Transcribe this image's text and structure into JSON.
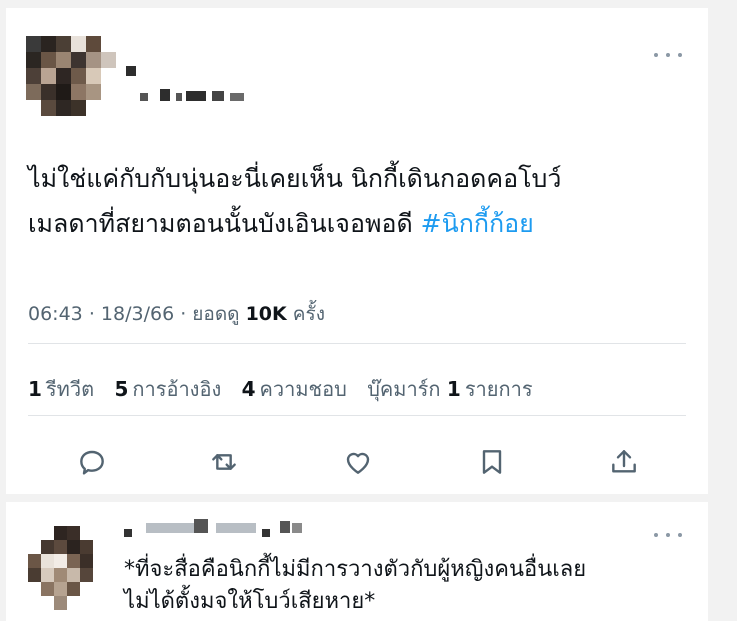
{
  "tweet": {
    "text_line1": "ไม่ใช่แค่กับกับนุ่นอะนี่เคยเห็น นิกกี้เดินกอดคอโบว์",
    "text_line2": "เมลดาที่สยามตอนนั้นบังเอินเจอพอดี ",
    "hashtag": "#นิกกี้ก้อย",
    "time": "06:43",
    "date": "18/3/66",
    "views_prefix": "ยอดดู",
    "views_count": "10K",
    "views_suffix": "ครั้ง"
  },
  "stats": {
    "retweets_count": "1",
    "retweets_label": "รีทวีต",
    "quotes_count": "5",
    "quotes_label": "การอ้างอิง",
    "likes_count": "4",
    "likes_label": "ความชอบ",
    "bookmarks_label": "บุ๊คมาร์ก",
    "bookmarks_count": "1",
    "bookmarks_unit": "รายการ"
  },
  "actions": [
    "reply-icon",
    "retweet-icon",
    "like-icon",
    "bookmark-icon",
    "share-icon"
  ],
  "reply": {
    "line1": "*ที่จะสื่อคือนิกกี้ไม่มีการวางตัวกับผู้หญิงคนอื่นเลย",
    "line2": "ไม่ได้ตั้งมจให้โบว์เสียหาย*"
  },
  "colors": {
    "hashtag": "#1d9bf0",
    "secondary_text": "#536471",
    "icon": "#536471"
  }
}
